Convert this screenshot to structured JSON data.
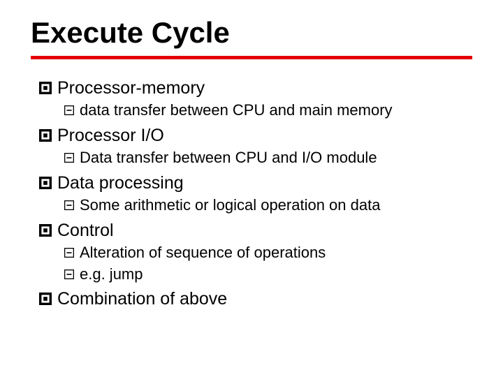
{
  "title": "Execute Cycle",
  "colors": {
    "rule": "#e40000",
    "bullet": "#000000",
    "text": "#000000"
  },
  "items": [
    {
      "label": "Processor-memory",
      "subs": [
        {
          "label": "data transfer between CPU and main memory"
        }
      ]
    },
    {
      "label": "Processor I/O",
      "subs": [
        {
          "label": "Data transfer between CPU and I/O module"
        }
      ]
    },
    {
      "label": "Data processing",
      "subs": [
        {
          "label": "Some arithmetic or logical operation on data"
        }
      ]
    },
    {
      "label": "Control",
      "subs": [
        {
          "label": "Alteration of sequence of operations"
        },
        {
          "label": "e.g. jump"
        }
      ]
    },
    {
      "label": "Combination of above",
      "subs": []
    }
  ]
}
